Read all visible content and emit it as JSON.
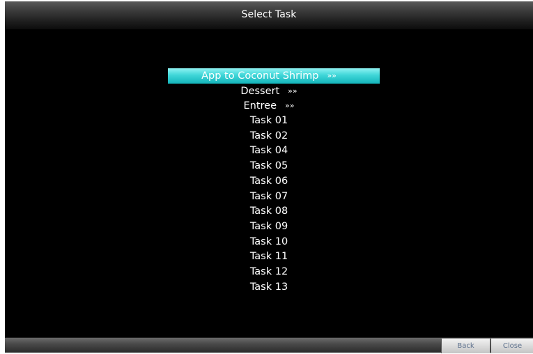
{
  "window": {
    "title": "Select Task"
  },
  "tasks": [
    {
      "label": "App to Coconut Shrimp",
      "chevron": "»»",
      "selected": true
    },
    {
      "label": "Dessert",
      "chevron": "»»",
      "selected": false
    },
    {
      "label": "Entree",
      "chevron": "»»",
      "selected": false
    },
    {
      "label": "Task 01",
      "chevron": "",
      "selected": false
    },
    {
      "label": "Task 02",
      "chevron": "",
      "selected": false
    },
    {
      "label": "Task 04",
      "chevron": "",
      "selected": false
    },
    {
      "label": "Task 05",
      "chevron": "",
      "selected": false
    },
    {
      "label": "Task 06",
      "chevron": "",
      "selected": false
    },
    {
      "label": "Task 07",
      "chevron": "",
      "selected": false
    },
    {
      "label": "Task 08",
      "chevron": "",
      "selected": false
    },
    {
      "label": "Task 09",
      "chevron": "",
      "selected": false
    },
    {
      "label": "Task 10",
      "chevron": "",
      "selected": false
    },
    {
      "label": "Task 11",
      "chevron": "",
      "selected": false
    },
    {
      "label": "Task 12",
      "chevron": "",
      "selected": false
    },
    {
      "label": "Task 13",
      "chevron": "",
      "selected": false
    }
  ],
  "footer": {
    "back_label": "Back",
    "close_label": "Close"
  },
  "colors": {
    "background": "#000000",
    "selection": "#3fd6d8",
    "text": "#ffffff",
    "button_text": "#5b6f8c"
  }
}
